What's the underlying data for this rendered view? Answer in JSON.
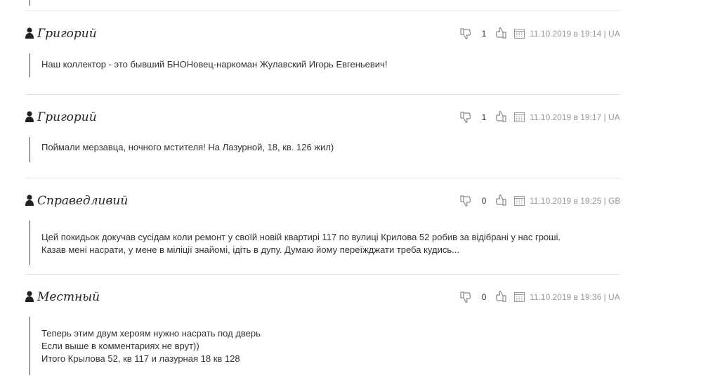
{
  "comments": [
    {
      "author": "Григорий",
      "votes": "1",
      "date": "11.10.2019 в 19:14 | UA",
      "lines": [
        "Наш коллектор - это бывший БНОНовец-наркоман Жулавский Игорь Евгеньевич!"
      ]
    },
    {
      "author": "Григорий",
      "votes": "1",
      "date": "11.10.2019 в 19:17 | UA",
      "lines": [
        "Поймали мерзавца, ночного мстителя! На Лазурной, 18, кв. 126 жил)"
      ]
    },
    {
      "author": "Справедливий",
      "votes": "0",
      "date": "11.10.2019 в 19:25 | GB",
      "lines": [
        "Цей покидьок докучав сусідам коли ремонт у своїй новій квартирі 117 по вулиці Крилова 52 робив за відібрані у нас гроші.",
        "Казав мені насрати, у мене в міліції знайомі, ідіть в дупу. Думаю йому переїжджати треба кудись..."
      ]
    },
    {
      "author": "Местный",
      "votes": "0",
      "date": "11.10.2019 в 19:36 | UA",
      "lines": [
        "Теперь этим двум хероям нужно насрать под дверь",
        "Если выше в комментариях не врут))",
        "Итого Крылова 52, кв 117 и лазурная 18 кв 128"
      ]
    }
  ],
  "icons": {
    "user": "user-icon",
    "thumb_down": "thumbs-down-icon",
    "thumb_up": "thumbs-up-icon",
    "calendar": "calendar-icon"
  },
  "colors": {
    "divider": "#e2e2e2",
    "meta_text": "#999999",
    "icon_gray": "#888888",
    "body_text": "#333333"
  }
}
